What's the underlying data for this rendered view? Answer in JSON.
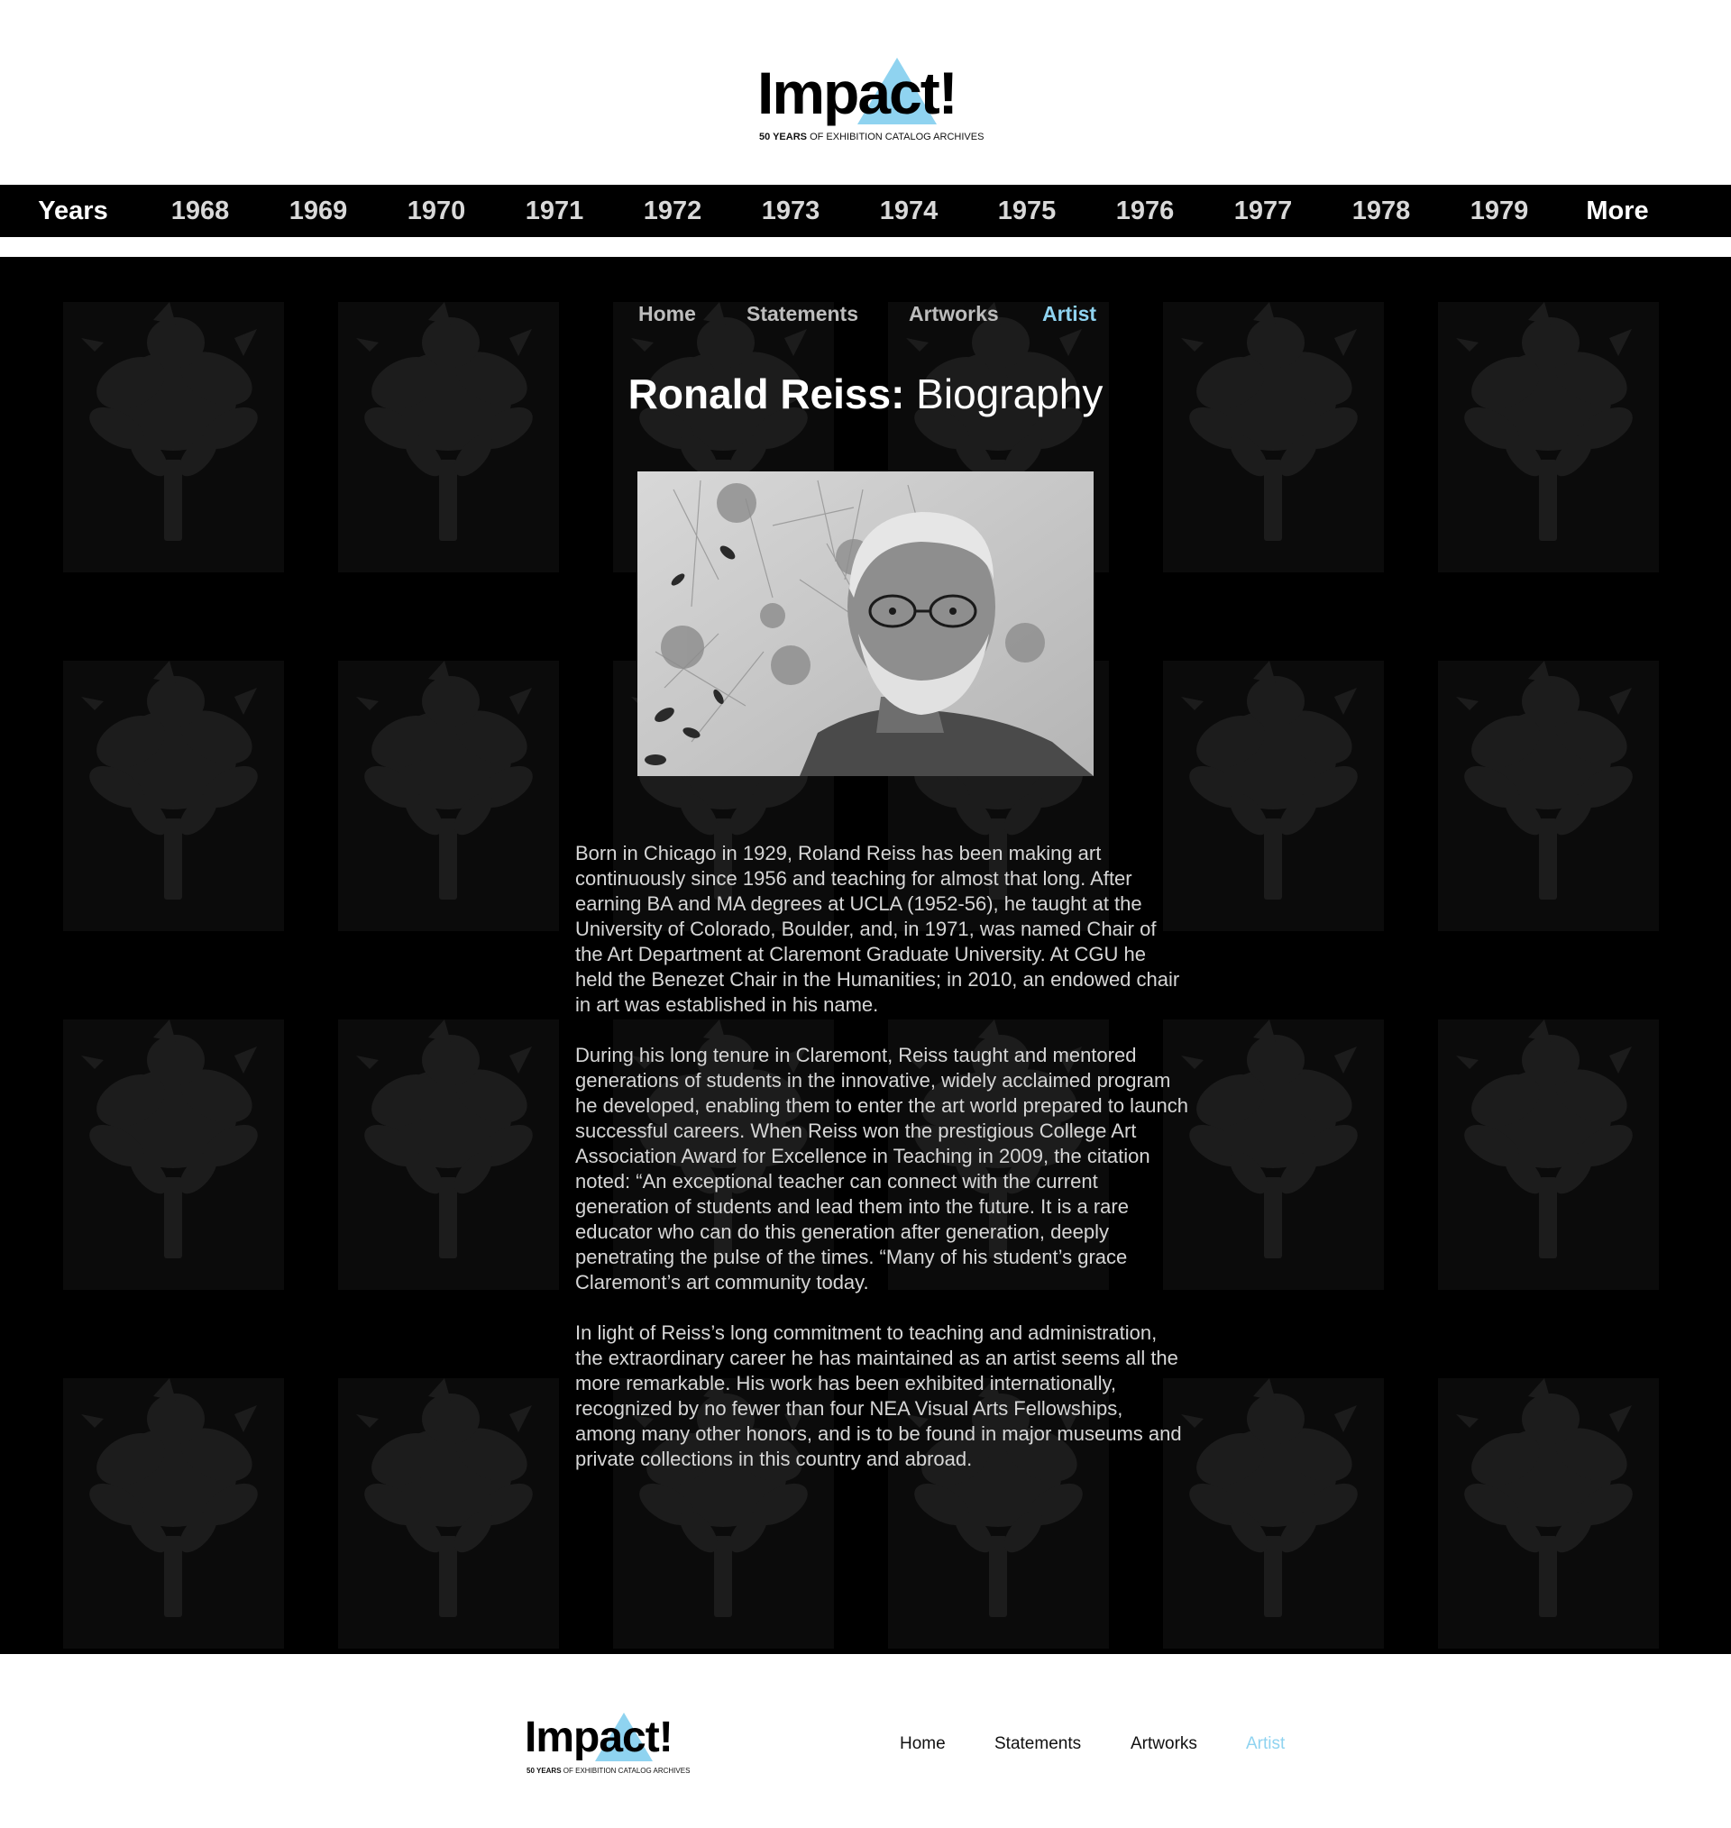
{
  "header": {
    "logo": {
      "word": "Impact!",
      "tag_bold": "50 YEARS",
      "tag_rest": "OF EXHIBITION CATALOG ARCHIVES"
    }
  },
  "year_nav": {
    "items": [
      "Years",
      "1968",
      "1969",
      "1970",
      "1971",
      "1972",
      "1973",
      "1974",
      "1975",
      "1976",
      "1977",
      "1978",
      "1979",
      "More"
    ]
  },
  "sub_nav": {
    "items": [
      "Home",
      "Statements",
      "Artworks",
      "Artist"
    ],
    "active": "Artist"
  },
  "page": {
    "title_name": "Ronald Reiss:",
    "title_rest": " Biography",
    "paragraphs": [
      "Born in Chicago in 1929, Roland Reiss has been making art continuously since 1956 and teaching for almost that long. After earning BA and MA degrees at UCLA (1952-56), he taught at the University of Colorado, Boulder, and, in 1971, was named Chair of the Art Department at Claremont Graduate University. At CGU he held the Benezet Chair in the Humanities; in 2010, an endowed chair in art was established in his name.",
      "During his long tenure in Claremont, Reiss taught and mentored generations of students in the innovative, widely acclaimed program he developed, enabling them to enter the art world prepared to launch successful careers. When Reiss won the prestigious College Art Association Award for Excellence in Teaching in 2009, the citation noted: “An exceptional teacher can connect with the current generation of students and lead them into the future. It is a rare educator who can do this generation after generation, deeply penetrating the pulse of the times. “Many of his student’s grace Claremont’s art community today.",
      "In light of Reiss’s long commitment to teaching and administration, the extraordinary career he has maintained as an artist seems all the more remarkable. His work has been exhibited internationally, recognized by no fewer than four NEA Visual Arts Fellowships, among many other honors, and is to be found in major museums and private collections in this country and abroad."
    ]
  },
  "footer": {
    "logo": {
      "word": "Impact!",
      "tag_bold": "50 YEARS",
      "tag_rest": "OF EXHIBITION CATALOG ARCHIVES"
    },
    "nav": [
      "Home",
      "Statements",
      "Artworks",
      "Artist"
    ],
    "active": "Artist"
  },
  "colors": {
    "accent": "#8fd3f0",
    "background_dark": "#000000"
  }
}
